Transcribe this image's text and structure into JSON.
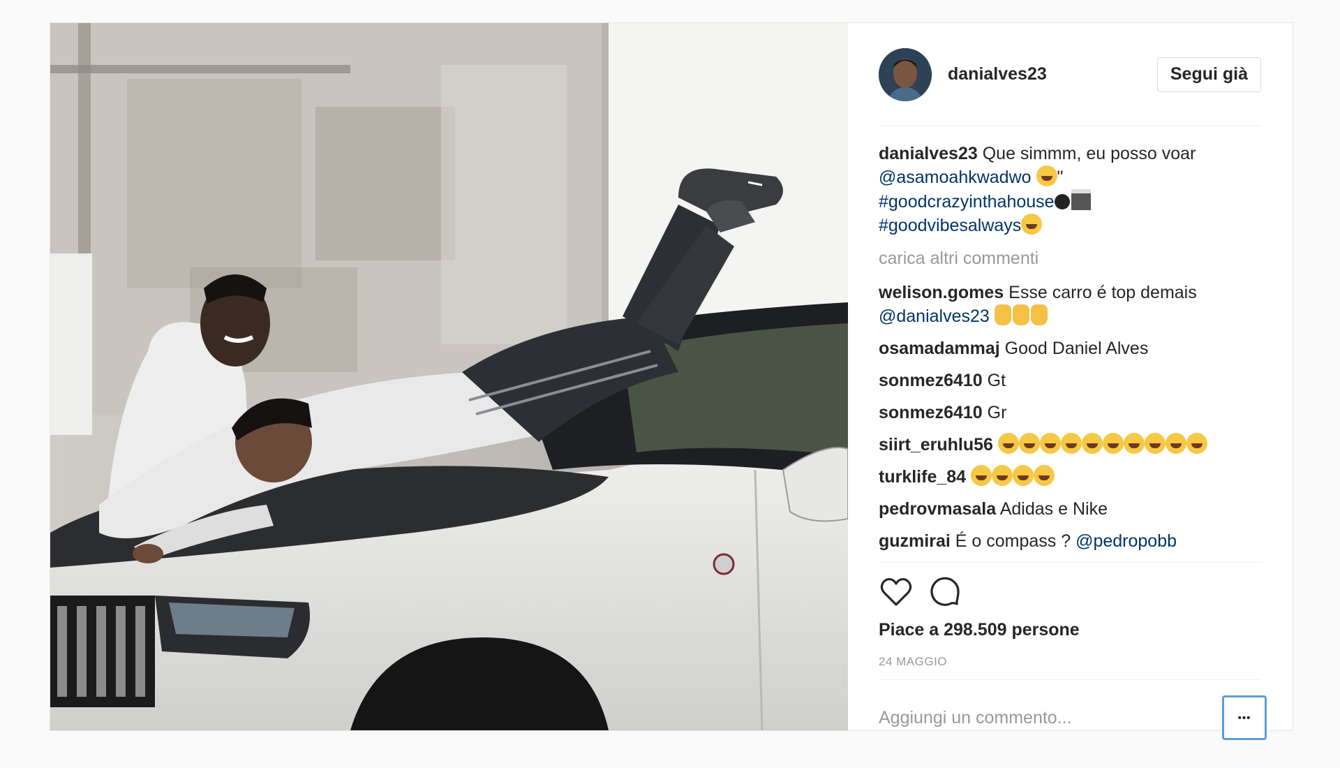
{
  "post": {
    "username": "danialves23",
    "follow_button": "Segui già",
    "caption": {
      "username": "danialves23",
      "text_1": "Que simmm, eu posso voar",
      "mention": "@asamoahkwadwo",
      "text_2": "\"",
      "hashtag_1": "#goodcrazyinthahouse",
      "hashtag_2": "#goodvibesalways"
    },
    "load_more": "carica altri commenti",
    "comments": [
      {
        "user": "welison.gomes",
        "text": "Esse carro é top demais",
        "mention": "@danialves23"
      },
      {
        "user": "osamadammaj",
        "text": "Good Daniel Alves"
      },
      {
        "user": "sonmez6410",
        "text": "Gt"
      },
      {
        "user": "sonmez6410",
        "text": "Gr"
      },
      {
        "user": "siirt_eruhlu56",
        "text": ""
      },
      {
        "user": "turklife_84",
        "text": ""
      },
      {
        "user": "pedrovmasala",
        "text": "Adidas e Nike"
      },
      {
        "user": "guzmirai",
        "text": "É o compass ?",
        "mention": "@pedropobb"
      }
    ],
    "likes": "Piace a 298.509 persone",
    "date": "24 MAGGIO",
    "comment_placeholder": "Aggiungi un commento...",
    "more_label": "•••",
    "icons": [
      "heart-icon",
      "comment-icon"
    ],
    "colors": {
      "mention": "#003569",
      "muted": "#999999",
      "text": "#262626",
      "focus": "#5b9dd9"
    }
  }
}
